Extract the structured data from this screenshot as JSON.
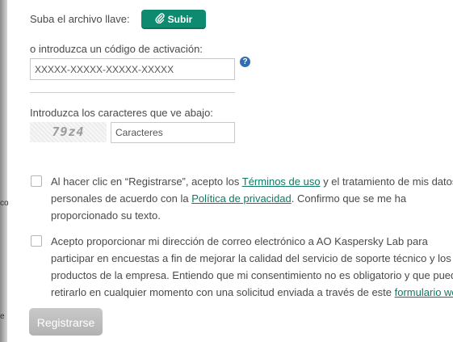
{
  "upload": {
    "label": "Suba el archivo llave:",
    "button_label": "Subir",
    "button_color": "#0d8a6f"
  },
  "activation": {
    "label": "o introduzca un código de activación:",
    "placeholder": "XXXXX-XXXXX-XXXXX-XXXXX",
    "help_glyph": "?"
  },
  "captcha": {
    "label": "Introduzca los caracteres que ve abajo:",
    "image_text": "79z4",
    "placeholder": "Caracteres"
  },
  "consent1": {
    "text_before": "Al hacer clic en “Registrarse”, acepto los ",
    "terms_link": "Términos de uso",
    "text_middle": " y el tratamiento de mis datos personales de acuerdo con la ",
    "privacy_link": "Política de privacidad",
    "text_after": ". Confirmo que se me ha proporcionado su texto."
  },
  "consent2": {
    "text_before": "Acepto proporcionar mi dirección de correo electrónico a AO Kaspersky Lab para participar en encuestas a fin de mejorar la calidad del servicio de soporte técnico y los productos de la empresa. Entiendo que mi consentimiento no es obligatorio y que puedo retirarlo en cualquier momento con una solicitud enviada a través de este ",
    "form_link": "formulario web"
  },
  "submit": {
    "label": "Registrarse"
  },
  "left_fragments": [
    "co",
    "e"
  ],
  "colors": {
    "link": "#0d7a63",
    "help_icon": "#2f6fb0",
    "disabled_button": "#bdbdbd"
  }
}
